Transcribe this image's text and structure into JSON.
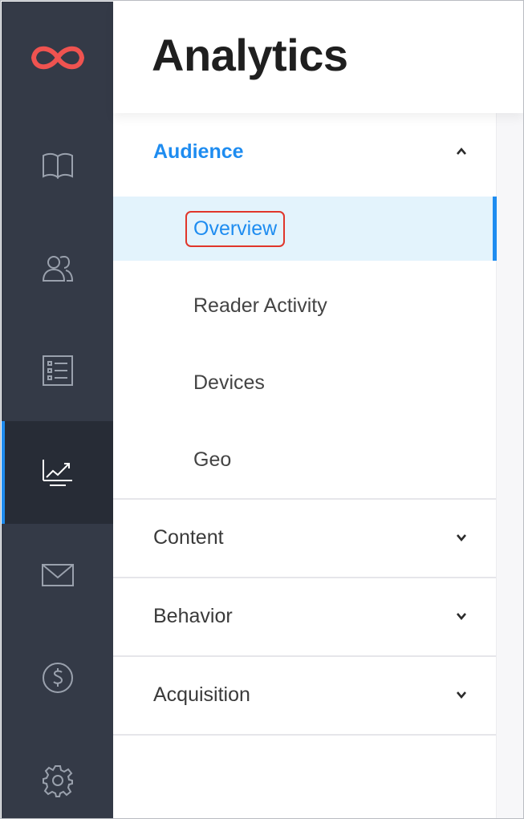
{
  "header": {
    "title": "Analytics"
  },
  "rail": {
    "items": [
      {
        "icon": "book-icon"
      },
      {
        "icon": "users-icon"
      },
      {
        "icon": "list-icon"
      },
      {
        "icon": "analytics-chart-icon",
        "active": true
      },
      {
        "icon": "mail-icon"
      },
      {
        "icon": "dollar-icon"
      },
      {
        "icon": "gear-icon"
      }
    ]
  },
  "menu": {
    "audience": {
      "label": "Audience",
      "expanded": true,
      "items": [
        {
          "label": "Overview",
          "selected": true
        },
        {
          "label": "Reader Activity"
        },
        {
          "label": "Devices"
        },
        {
          "label": "Geo"
        }
      ]
    },
    "content": {
      "label": "Content"
    },
    "behavior": {
      "label": "Behavior"
    },
    "acquisition": {
      "label": "Acquisition"
    }
  },
  "colors": {
    "accent": "#1e8cf0",
    "rail_bg": "#343a47",
    "selected_bg": "#e3f3fc",
    "logo": "#ef5350",
    "highlight_box": "#e0362b"
  }
}
